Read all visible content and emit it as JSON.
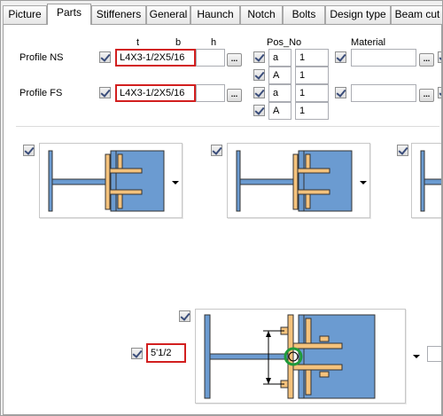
{
  "tabs": [
    "Picture",
    "Parts",
    "Stiffeners",
    "General",
    "Haunch",
    "Notch",
    "Bolts",
    "Design type",
    "Beam cut"
  ],
  "active_tab": "Parts",
  "columns": {
    "t": "t",
    "b": "b",
    "h": "h",
    "pos_no": "Pos_No",
    "material": "Material"
  },
  "rows": [
    {
      "label": "Profile NS",
      "profile": "L4X3-1/2X5/16",
      "pos_prefix_1": "a",
      "pos_number_1": "1",
      "pos_prefix_2": "A",
      "pos_number_2": "1"
    },
    {
      "label": "Profile FS",
      "profile": "L4X3-1/2X5/16",
      "pos_prefix_1": "a",
      "pos_number_1": "1",
      "pos_prefix_2": "A",
      "pos_number_2": "1"
    }
  ],
  "browse_label": "...",
  "distance_value": "5'1/2",
  "icons": {
    "checkbox": "check-icon",
    "dropdown": "triangle-down-icon",
    "detail_picture": "beam-clip-angle-detail-icon"
  },
  "colors": {
    "blue_plate": "#6b9bd1",
    "angle": "#f4c27c",
    "angle_edge": "#333333",
    "highlight_red": "#d21f1f",
    "marker_green": "#1f9a3a"
  }
}
